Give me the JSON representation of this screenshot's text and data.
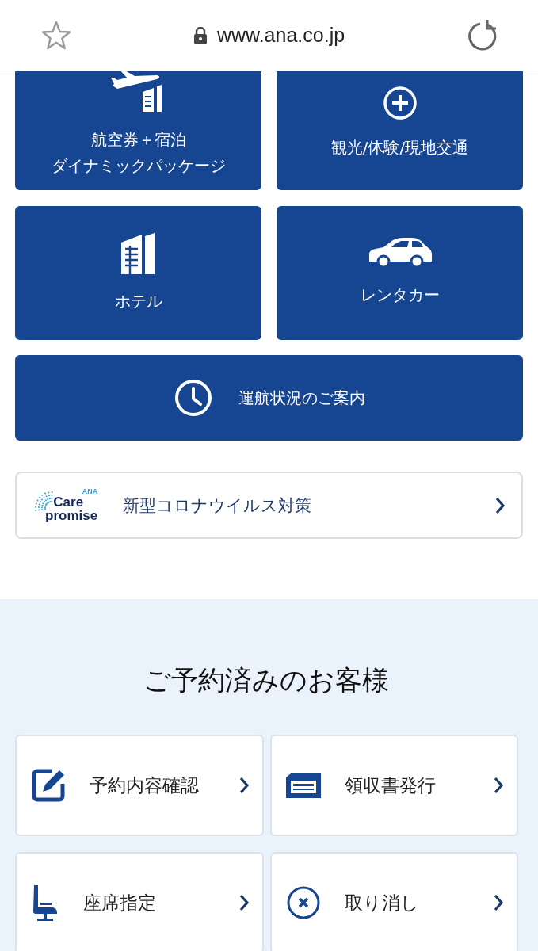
{
  "browser": {
    "url": "www.ana.co.jp",
    "secure": true
  },
  "tiles": [
    {
      "kind": "package",
      "lines": [
        "航空券＋宿泊",
        "ダイナミックパッケージ"
      ]
    },
    {
      "kind": "plus",
      "label": "観光/体験/現地交通"
    },
    {
      "kind": "hotel",
      "label": "ホテル"
    },
    {
      "kind": "car",
      "label": "レンタカー"
    }
  ],
  "flight_status": {
    "label": "運航状況のご案内"
  },
  "care_banner": {
    "logo": [
      "ANA",
      "Care",
      "promise"
    ],
    "label": "新型コロナウイルス対策"
  },
  "reserved": {
    "title": "ご予約済みのお客様",
    "items": [
      {
        "kind": "edit",
        "label": "予約内容確認"
      },
      {
        "kind": "receipt",
        "label": "領収書発行"
      },
      {
        "kind": "seat",
        "label": "座席指定"
      },
      {
        "kind": "cancel",
        "label": "取り消し"
      }
    ]
  }
}
